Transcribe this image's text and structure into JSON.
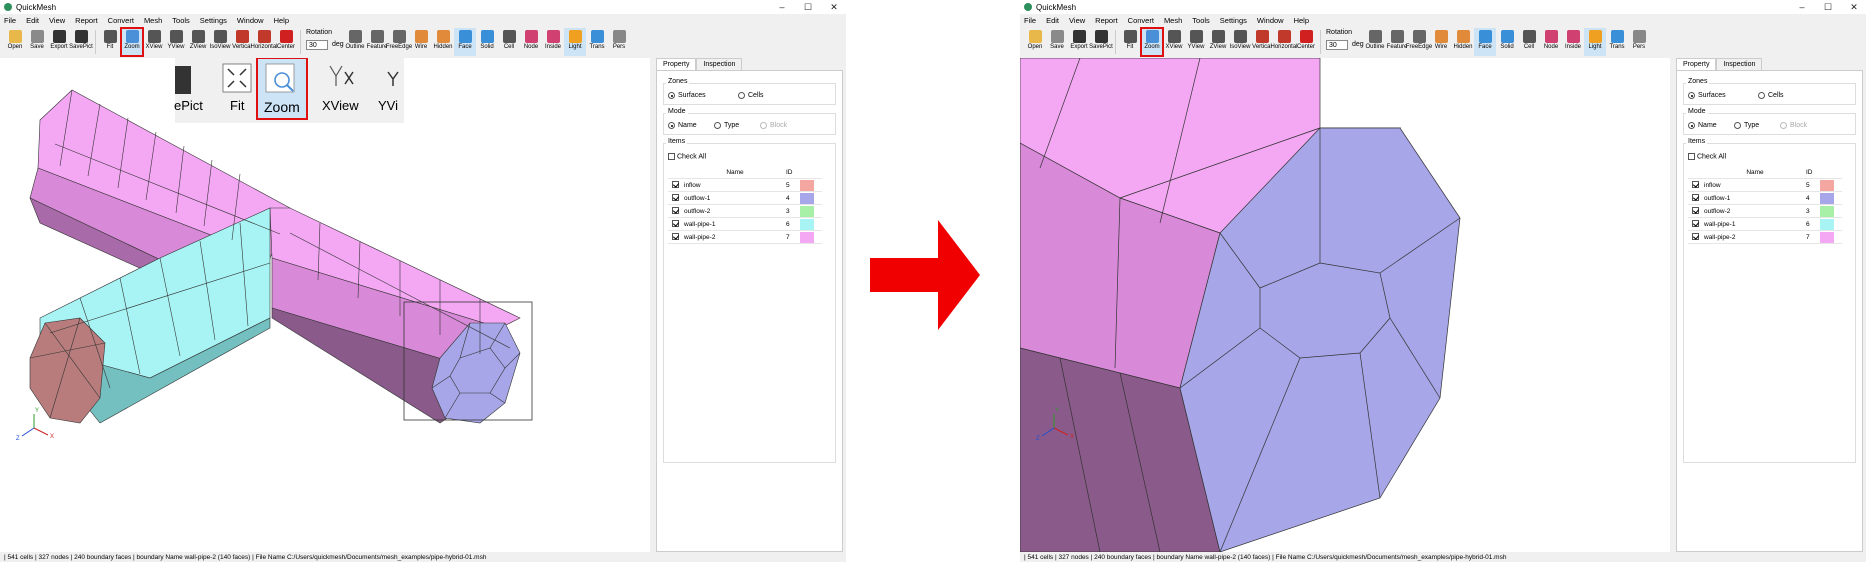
{
  "app": {
    "title": "QuickMesh",
    "min": "–",
    "max": "☐",
    "close": "✕"
  },
  "menu": [
    "File",
    "Edit",
    "View",
    "Report",
    "Convert",
    "Mesh",
    "Tools",
    "Settings",
    "Window",
    "Help"
  ],
  "toolbar": {
    "buttons": [
      {
        "label": "Open",
        "icon": "folder-open-icon",
        "color": "#e8b84a"
      },
      {
        "label": "Save",
        "icon": "save-icon",
        "color": "#8a8a8a"
      },
      {
        "label": "Export",
        "icon": "export-icon",
        "color": "#333333"
      },
      {
        "label": "SavePict",
        "icon": "camera-icon",
        "color": "#333333"
      },
      {
        "label": "Fit",
        "icon": "fit-icon",
        "color": "#555555"
      },
      {
        "label": "Zoom",
        "icon": "zoom-icon",
        "color": "#4a90d9"
      },
      {
        "label": "XView",
        "icon": "xview-icon",
        "color": "#555555"
      },
      {
        "label": "YView",
        "icon": "yview-icon",
        "color": "#555555"
      },
      {
        "label": "ZView",
        "icon": "zview-icon",
        "color": "#555555"
      },
      {
        "label": "IsoView",
        "icon": "isoview-icon",
        "color": "#555555"
      },
      {
        "label": "Vertical",
        "icon": "vertical-icon",
        "color": "#c0392b"
      },
      {
        "label": "Horizontal",
        "icon": "horizontal-icon",
        "color": "#c0392b"
      },
      {
        "label": "Center",
        "icon": "center-icon",
        "color": "#d02020"
      }
    ],
    "rotation": {
      "label": "Rotation",
      "value": "30",
      "unit": "deg"
    },
    "buttons2": [
      {
        "label": "Outline",
        "icon": "outline-icon",
        "color": "#666666"
      },
      {
        "label": "Feature",
        "icon": "feature-icon",
        "color": "#666666"
      },
      {
        "label": "FreeEdge",
        "icon": "freeedge-icon",
        "color": "#666666"
      },
      {
        "label": "Wire",
        "icon": "wire-icon",
        "color": "#e08a3a"
      },
      {
        "label": "Hidden",
        "icon": "hidden-icon",
        "color": "#e08a3a"
      },
      {
        "label": "Face",
        "icon": "face-icon",
        "color": "#3a8fd9"
      },
      {
        "label": "Solid",
        "icon": "solid-icon",
        "color": "#3a8fd9"
      },
      {
        "label": "Cell",
        "icon": "cell-icon",
        "color": "#555555"
      },
      {
        "label": "Node",
        "icon": "node-icon",
        "color": "#d04070"
      },
      {
        "label": "Inside",
        "icon": "inside-icon",
        "color": "#d04070"
      },
      {
        "label": "Light",
        "icon": "light-icon",
        "color": "#f0a020"
      },
      {
        "label": "Trans",
        "icon": "trans-icon",
        "color": "#3a8fd9"
      },
      {
        "label": "Pers",
        "icon": "pers-icon",
        "color": "#888888"
      }
    ]
  },
  "zoom_inset": [
    "ePict",
    "Fit",
    "Zoom",
    "XView",
    "YVi"
  ],
  "panel": {
    "tabs": [
      "Property",
      "Inspection"
    ],
    "zones": {
      "label": "Zones",
      "options": [
        "Surfaces",
        "Cells"
      ]
    },
    "mode": {
      "label": "Mode",
      "options": [
        "Name",
        "Type",
        "Block"
      ]
    },
    "items": {
      "label": "Items",
      "check_all": "Check All",
      "columns": [
        "Name",
        "ID"
      ],
      "rows": [
        {
          "name": "inflow",
          "id": "5",
          "color": "#f4a7a0"
        },
        {
          "name": "outflow-1",
          "id": "4",
          "color": "#a6a6e8"
        },
        {
          "name": "outflow-2",
          "id": "3",
          "color": "#a8f0a8"
        },
        {
          "name": "wall-pipe-1",
          "id": "6",
          "color": "#a8f4f4"
        },
        {
          "name": "wall-pipe-2",
          "id": "7",
          "color": "#f4a8f4"
        }
      ]
    }
  },
  "axis": {
    "x": "X",
    "y": "Y",
    "z": "Z"
  },
  "status": "| 541 cells | 327 nodes | 240 boundary faces |  boundary Name wall-pipe-2 (140 faces) | File Name C:/Users/quickmesh/Documents/mesh_examples/pipe-hybrid-01.msh",
  "colors": {
    "accent": "#e01010",
    "pink": "#f4a8f4",
    "cyan": "#a8f4f4",
    "blue": "#a6a6e8",
    "brown": "#b87c7c"
  }
}
